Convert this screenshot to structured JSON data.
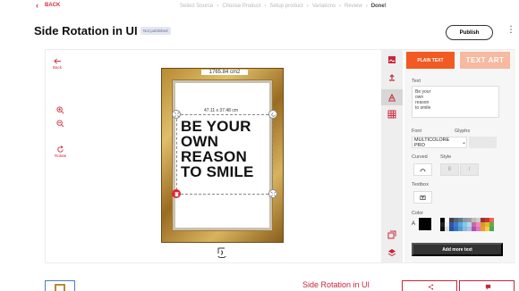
{
  "nav": {
    "back_label": "BACK",
    "steps": [
      "Select Source",
      "Choose Product",
      "Setup product",
      "Variations",
      "Review",
      "Done!"
    ]
  },
  "header": {
    "title": "Side Rotation in UI",
    "status_badge": "Not published",
    "publish_label": "Publish"
  },
  "left_tools": {
    "back_label": "Back",
    "rotate_label": "Rotate"
  },
  "canvas": {
    "area_label": "1765.84 cm2",
    "text_dimensions": "47.11 x 37.48 cm",
    "phrase_lines": [
      "BE YOUR",
      "OWN",
      "REASON",
      "TO SMILE"
    ]
  },
  "panel": {
    "tabs": {
      "plain_text": "PLAIN TEXT",
      "text_art": "TEXT ART"
    },
    "text_label": "Text",
    "text_value": "Be your\nown\nreason\nto smile",
    "font_label": "Font",
    "font_value": "MULTICOLORE PRO",
    "glyphs_label": "Glyphs",
    "curved_label": "Curved",
    "style_label": "Style",
    "bold_label": "B",
    "italic_label": "I",
    "textbox_label": "Textbox",
    "color_label": "Color",
    "color_letter": "A",
    "add_more_text": "Add more text",
    "swatch_colors": [
      "#000000",
      "#ffffff",
      "#444444",
      "#556677",
      "#667788",
      "#8899aa",
      "#a0a0a0",
      "#bbbbbb",
      "#cccccc",
      "#993333",
      "#cc3333",
      "#ee6655",
      "#222222",
      "#eeeeee",
      "#3355aa",
      "#4477cc",
      "#55aadd",
      "#77ccee",
      "#aaddee",
      "#cc66aa",
      "#ee88bb",
      "#dd9922",
      "#ddbb33",
      "#66aa44",
      "#111111",
      "#dddddd",
      "#2255aa",
      "#3377bb",
      "#5599cc",
      "#88bbdd",
      "#bbbbdd",
      "#aa55aa",
      "#dd77cc",
      "#ee9933",
      "#ffcc44",
      "#44aa55"
    ]
  },
  "bottom": {
    "title": "Side Rotation in UI"
  },
  "colors": {
    "accent": "#d22c3c",
    "orange": "#f25a22",
    "dark": "#333333"
  }
}
